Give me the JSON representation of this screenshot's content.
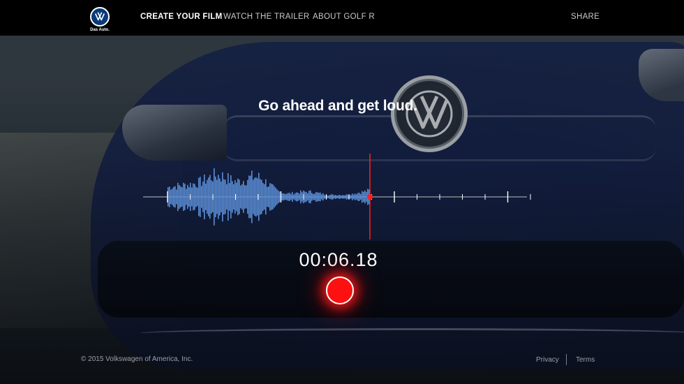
{
  "brand": {
    "logo_caption": "Das Auto."
  },
  "nav": {
    "items": [
      {
        "label": "CREATE YOUR FILM",
        "active": true
      },
      {
        "label": "WATCH THE TRAILER",
        "active": false
      },
      {
        "label": "ABOUT GOLF R",
        "active": false
      }
    ],
    "share_label": "SHARE"
  },
  "hero": {
    "headline": "Go ahead and get loud.",
    "timer": "00:06.18"
  },
  "recorder": {
    "playhead_progress": 0.58,
    "wave_color": "#5b8ed6",
    "playhead_color": "#ff2020"
  },
  "footer": {
    "copyright": "© 2015 Volkswagen of America, Inc.",
    "privacy_label": "Privacy",
    "terms_label": "Terms"
  },
  "colors": {
    "nav_bg": "#000000",
    "record_red": "#ff1010"
  }
}
